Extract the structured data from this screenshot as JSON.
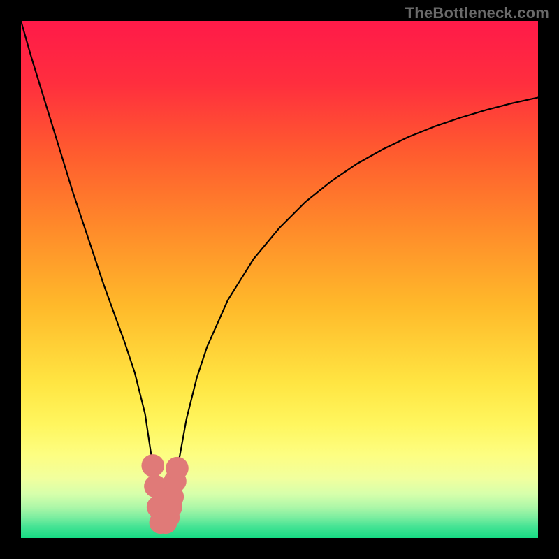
{
  "watermark": "TheBottleneck.com",
  "chart_data": {
    "type": "line",
    "title": "",
    "xlabel": "",
    "ylabel": "",
    "xlim": [
      0,
      100
    ],
    "ylim": [
      0,
      100
    ],
    "legend": null,
    "grid": false,
    "annotations": [],
    "series": [
      {
        "name": "curve",
        "color": "#000000",
        "x": [
          0,
          2,
          4,
          6,
          8,
          10,
          12,
          14,
          16,
          18,
          20,
          22,
          24,
          25.5,
          26.5,
          27,
          27.5,
          28,
          29,
          30,
          32,
          34,
          36,
          40,
          45,
          50,
          55,
          60,
          65,
          70,
          75,
          80,
          85,
          90,
          95,
          100
        ],
        "y": [
          100,
          93,
          86.5,
          80,
          73.5,
          67,
          61,
          55,
          49,
          43.5,
          38,
          32,
          24,
          14,
          6,
          3,
          2,
          3,
          6,
          12,
          23,
          31,
          37,
          46,
          54,
          60,
          65,
          69,
          72.4,
          75.2,
          77.6,
          79.6,
          81.3,
          82.8,
          84.1,
          85.2
        ]
      }
    ],
    "markers": [
      {
        "x": 25.5,
        "y": 14,
        "color": "#e07a78",
        "r": 2.2
      },
      {
        "x": 26.0,
        "y": 10,
        "color": "#e07a78",
        "r": 2.2
      },
      {
        "x": 26.5,
        "y": 6,
        "color": "#e07a78",
        "r": 2.2
      },
      {
        "x": 27.0,
        "y": 3,
        "color": "#e07a78",
        "r": 2.2
      },
      {
        "x": 28.0,
        "y": 3,
        "color": "#e07a78",
        "r": 2.2
      },
      {
        "x": 28.5,
        "y": 4,
        "color": "#e07a78",
        "r": 2.2
      },
      {
        "x": 29.0,
        "y": 6,
        "color": "#e07a78",
        "r": 2.2
      },
      {
        "x": 29.3,
        "y": 8,
        "color": "#e07a78",
        "r": 2.2
      },
      {
        "x": 29.8,
        "y": 11,
        "color": "#e07a78",
        "r": 2.2
      },
      {
        "x": 30.2,
        "y": 13.5,
        "color": "#e07a78",
        "r": 2.2
      }
    ],
    "background_gradient": {
      "stops": [
        {
          "pos": 0.0,
          "color": "#ff1a49"
        },
        {
          "pos": 0.12,
          "color": "#ff2e3e"
        },
        {
          "pos": 0.25,
          "color": "#ff5a2f"
        },
        {
          "pos": 0.4,
          "color": "#ff8a2a"
        },
        {
          "pos": 0.55,
          "color": "#ffb92a"
        },
        {
          "pos": 0.7,
          "color": "#ffe542"
        },
        {
          "pos": 0.78,
          "color": "#fff65e"
        },
        {
          "pos": 0.84,
          "color": "#fdfe82"
        },
        {
          "pos": 0.885,
          "color": "#f1ff9e"
        },
        {
          "pos": 0.915,
          "color": "#d6ffab"
        },
        {
          "pos": 0.94,
          "color": "#aef7a8"
        },
        {
          "pos": 0.96,
          "color": "#7ceea0"
        },
        {
          "pos": 0.978,
          "color": "#45e394"
        },
        {
          "pos": 1.0,
          "color": "#16db84"
        }
      ]
    }
  }
}
